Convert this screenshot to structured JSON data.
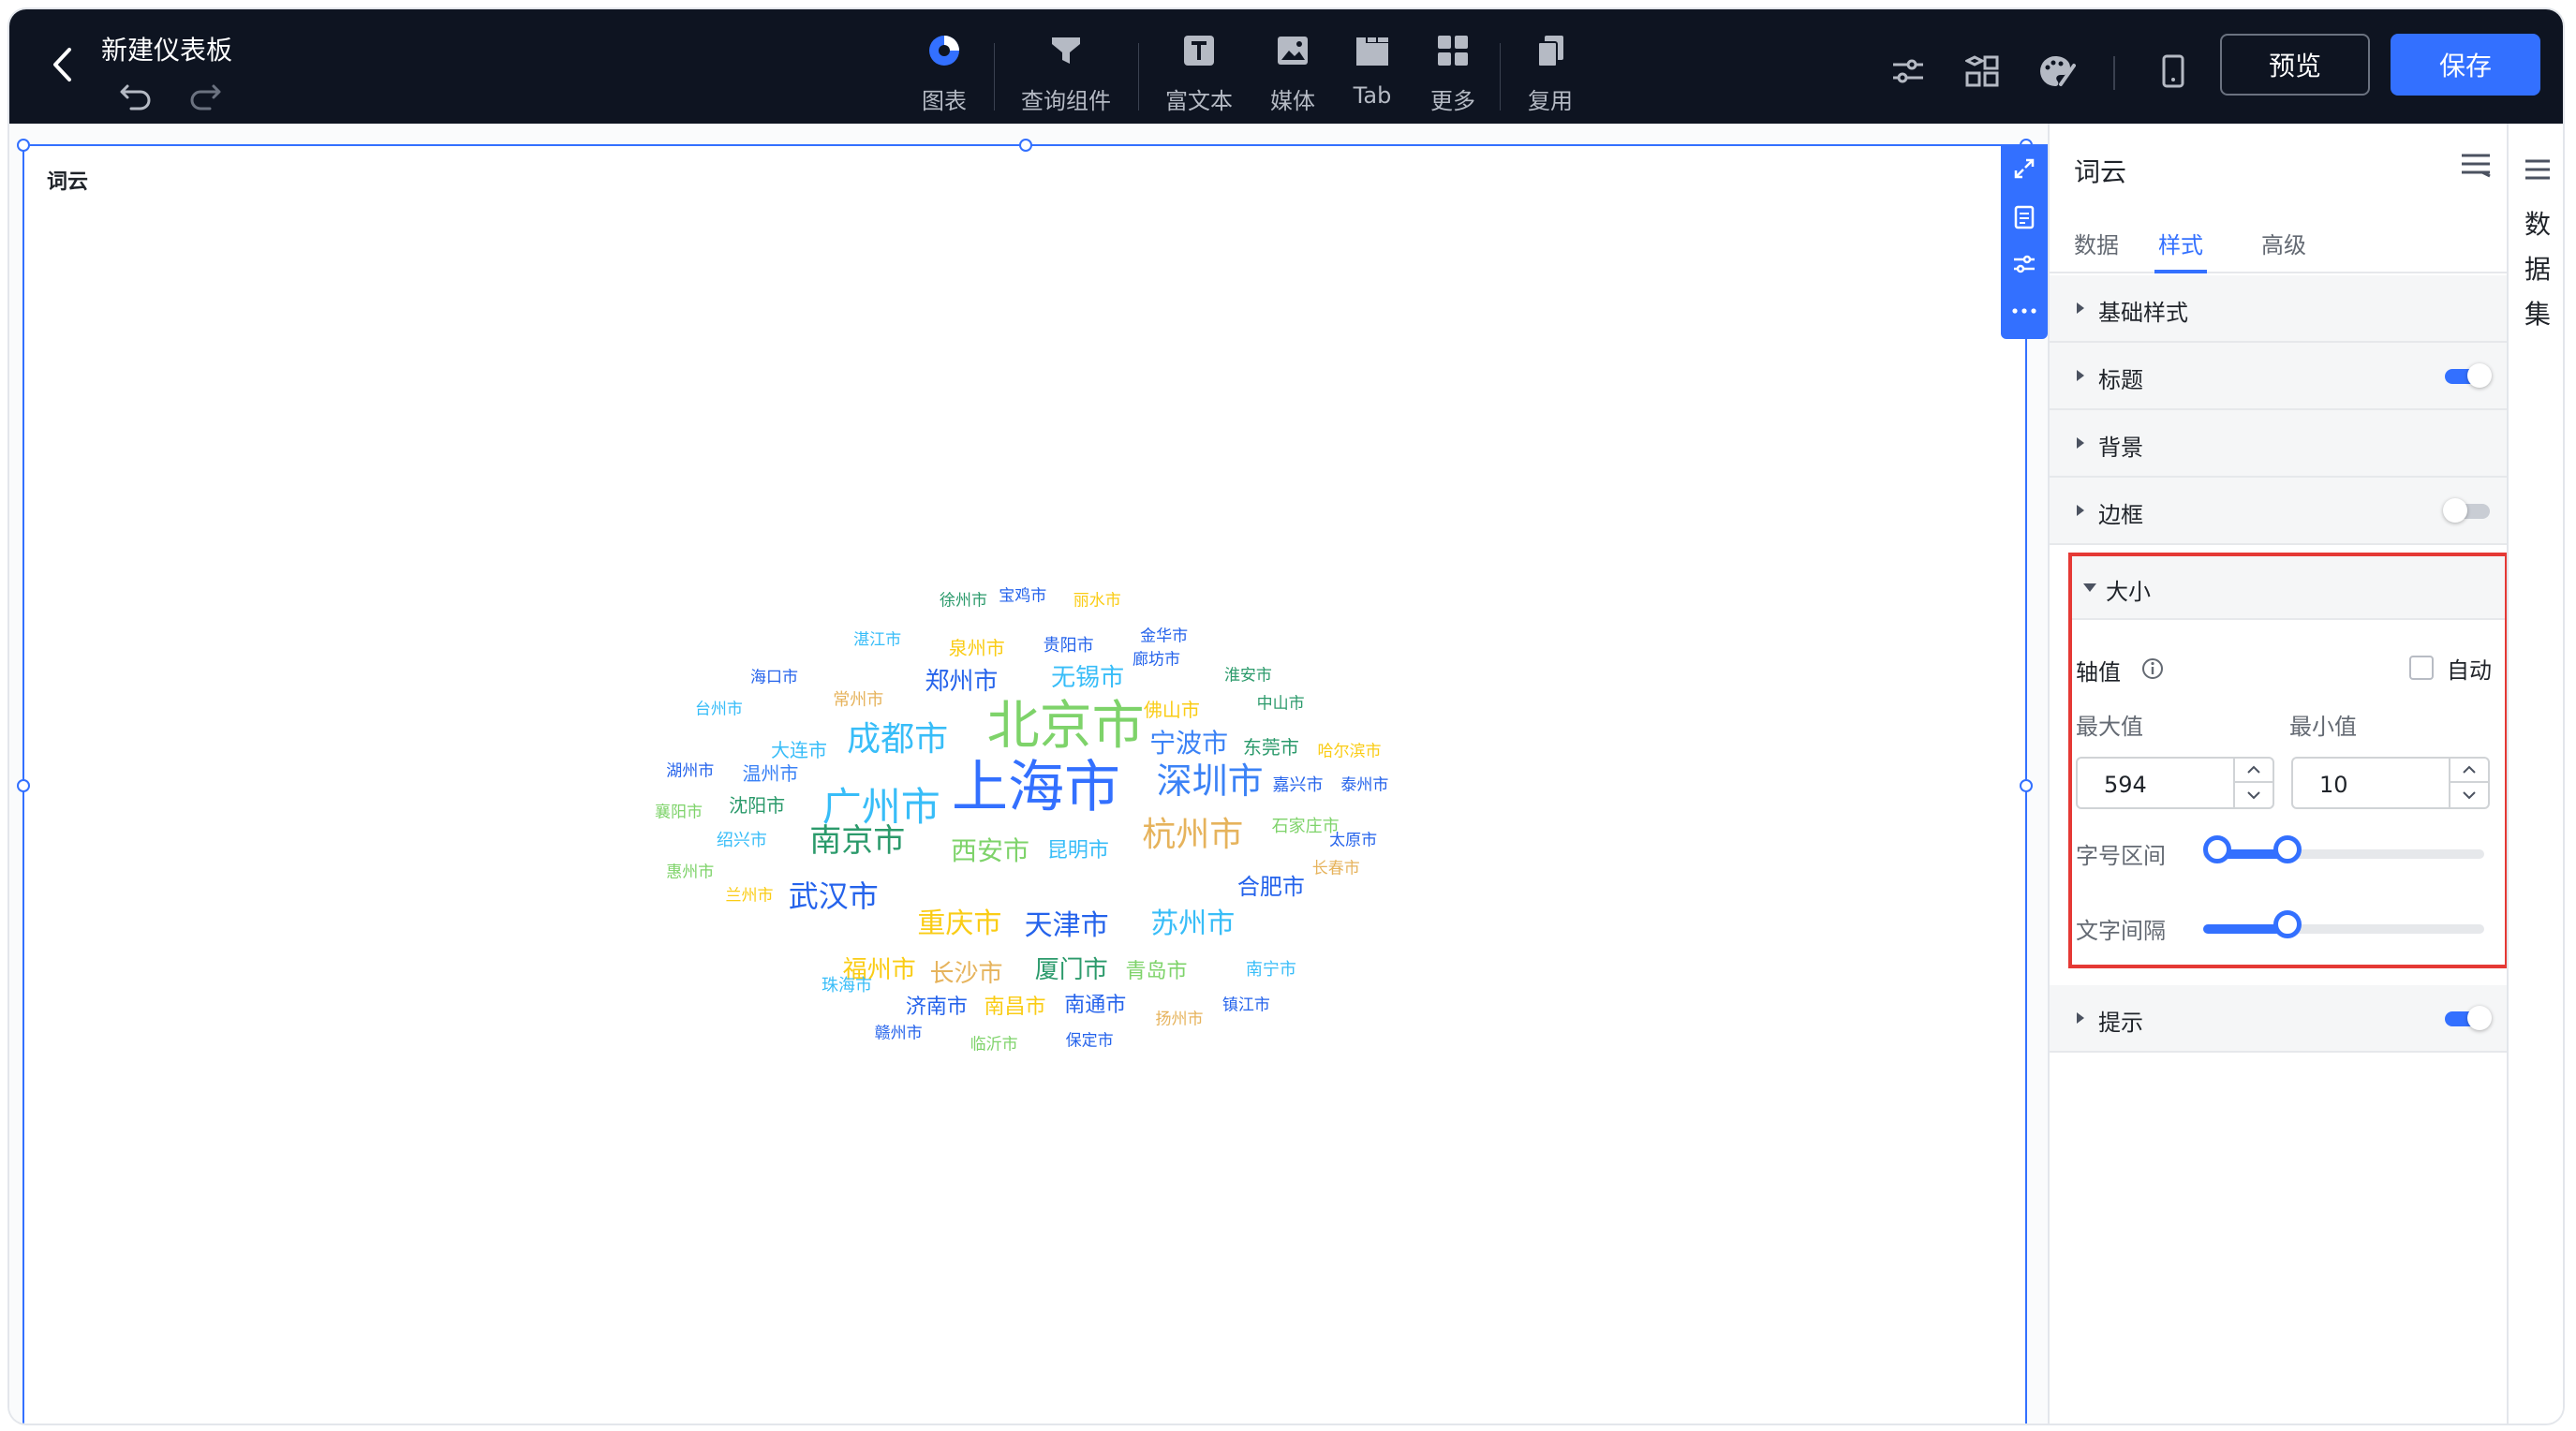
{
  "header": {
    "doc_title": "新建仪表板",
    "tools": [
      {
        "label": "图表",
        "icon": "pie-chart-icon"
      },
      {
        "label": "查询组件",
        "icon": "filter-icon"
      },
      {
        "label": "富文本",
        "icon": "text-icon"
      },
      {
        "label": "媒体",
        "icon": "image-icon"
      },
      {
        "label": "Tab",
        "icon": "tab-icon"
      },
      {
        "label": "更多",
        "icon": "grid-icon"
      },
      {
        "label": "复用",
        "icon": "copy-icon"
      }
    ],
    "preview_label": "预览",
    "save_label": "保存",
    "accent": "#3370ff",
    "bg": "#0e1421"
  },
  "widget": {
    "title": "词云",
    "words": [
      {
        "text": "上海市",
        "color": "#3370ff"
      },
      {
        "text": "北京市",
        "color": "#7ed36a"
      },
      {
        "text": "广州市",
        "color": "#38bdf8"
      },
      {
        "text": "深圳市",
        "color": "#3b82f6"
      },
      {
        "text": "成都市",
        "color": "#38bdf8"
      },
      {
        "text": "杭州市",
        "color": "#e6b35c"
      },
      {
        "text": "南京市",
        "color": "#2b9a6b"
      },
      {
        "text": "武汉市",
        "color": "#2563eb"
      },
      {
        "text": "重庆市",
        "color": "#facc15"
      },
      {
        "text": "天津市",
        "color": "#2563eb"
      },
      {
        "text": "苏州市",
        "color": "#38bdf8"
      },
      {
        "text": "西安市",
        "color": "#7ed36a"
      },
      {
        "text": "宁波市",
        "color": "#3b82f6"
      },
      {
        "text": "郑州市",
        "color": "#2563eb"
      },
      {
        "text": "无锡市",
        "color": "#38bdf8"
      },
      {
        "text": "长沙市",
        "color": "#e6b35c"
      },
      {
        "text": "福州市",
        "color": "#facc15"
      },
      {
        "text": "厦门市",
        "color": "#2b9a6b"
      },
      {
        "text": "合肥市",
        "color": "#2563eb"
      },
      {
        "text": "青岛市",
        "color": "#7ed36a"
      },
      {
        "text": "昆明市",
        "color": "#38bdf8"
      },
      {
        "text": "济南市",
        "color": "#2563eb"
      },
      {
        "text": "南昌市",
        "color": "#facc15"
      },
      {
        "text": "南通市",
        "color": "#2563eb"
      },
      {
        "text": "佛山市",
        "color": "#facc15"
      },
      {
        "text": "东莞市",
        "color": "#2b9a6b"
      },
      {
        "text": "沈阳市",
        "color": "#2b9a6b"
      },
      {
        "text": "大连市",
        "color": "#38bdf8"
      },
      {
        "text": "温州市",
        "color": "#3b82f6"
      },
      {
        "text": "泉州市",
        "color": "#facc15"
      },
      {
        "text": "贵阳市",
        "color": "#2563eb"
      },
      {
        "text": "常州市",
        "color": "#e6b35c"
      },
      {
        "text": "嘉兴市",
        "color": "#2563eb"
      },
      {
        "text": "石家庄市",
        "color": "#7ed36a"
      },
      {
        "text": "南宁市",
        "color": "#38bdf8"
      },
      {
        "text": "珠海市",
        "color": "#38bdf8"
      },
      {
        "text": "绍兴市",
        "color": "#38bdf8"
      },
      {
        "text": "徐州市",
        "color": "#2b9a6b"
      },
      {
        "text": "宝鸡市",
        "color": "#2563eb"
      },
      {
        "text": "丽水市",
        "color": "#facc15"
      },
      {
        "text": "金华市",
        "color": "#2563eb"
      },
      {
        "text": "廊坊市",
        "color": "#2563eb"
      },
      {
        "text": "淮安市",
        "color": "#2b9a6b"
      },
      {
        "text": "湛江市",
        "color": "#38bdf8"
      },
      {
        "text": "海口市",
        "color": "#2563eb"
      },
      {
        "text": "台州市",
        "color": "#38bdf8"
      },
      {
        "text": "中山市",
        "color": "#2b9a6b"
      },
      {
        "text": "哈尔滨市",
        "color": "#facc15"
      },
      {
        "text": "湖州市",
        "color": "#2563eb"
      },
      {
        "text": "泰州市",
        "color": "#2563eb"
      },
      {
        "text": "襄阳市",
        "color": "#7ed36a"
      },
      {
        "text": "太原市",
        "color": "#2563eb"
      },
      {
        "text": "惠州市",
        "color": "#7ed36a"
      },
      {
        "text": "长春市",
        "color": "#e6b35c"
      },
      {
        "text": "兰州市",
        "color": "#facc15"
      },
      {
        "text": "镇江市",
        "color": "#2563eb"
      },
      {
        "text": "扬州市",
        "color": "#e6b35c"
      },
      {
        "text": "赣州市",
        "color": "#2563eb"
      },
      {
        "text": "临沂市",
        "color": "#7ed36a"
      },
      {
        "text": "保定市",
        "color": "#2563eb"
      }
    ]
  },
  "panel": {
    "title": "词云",
    "tabs": [
      "数据",
      "样式",
      "高级"
    ],
    "active_tab": "样式",
    "sections": [
      {
        "label": "基础样式",
        "toggle": null
      },
      {
        "label": "标题",
        "toggle": true
      },
      {
        "label": "背景",
        "toggle": null
      },
      {
        "label": "边框",
        "toggle": false
      },
      {
        "label": "大小",
        "toggle": null
      },
      {
        "label": "提示",
        "toggle": true
      }
    ],
    "size": {
      "axis_label": "轴值",
      "auto_label": "自动",
      "auto_checked": false,
      "max_label": "最大值",
      "min_label": "最小值",
      "max_value": "594",
      "min_value": "10",
      "font_range_label": "字号区间",
      "font_range": [
        0.05,
        0.3
      ],
      "spacing_label": "文字间隔",
      "spacing": 0.3
    }
  },
  "rail": {
    "label": "数据集",
    "chars": [
      "数",
      "据",
      "集"
    ]
  }
}
